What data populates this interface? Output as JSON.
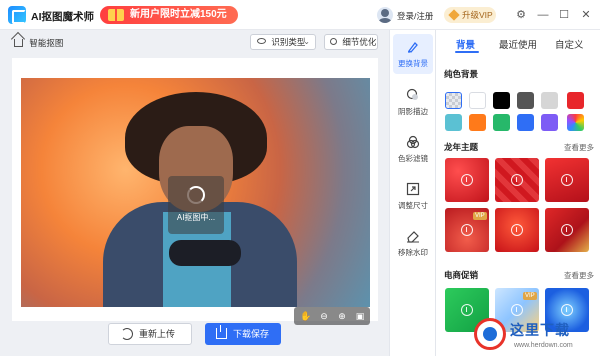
{
  "app": {
    "title": "AI抠图魔术师"
  },
  "promo": {
    "text": "新用户限时立减150元"
  },
  "account": {
    "login_label": "登录/注册",
    "vip_label": "升级VIP"
  },
  "window_controls": {
    "settings": "⚙",
    "minimize": "—",
    "maximize": "☐",
    "close": "✕"
  },
  "toolbar": {
    "smart_cutout_label": "智能抠图",
    "recognition_type_label": "识别类型",
    "detail_optimize_label": "细节优化"
  },
  "canvas": {
    "loading_text": "AI抠图中..."
  },
  "zoom_bar": {
    "icons": [
      "hand-icon",
      "zoom-out-icon",
      "zoom-in-icon",
      "fit-icon"
    ]
  },
  "actions": {
    "reupload_label": "重新上传",
    "download_label": "下载保存"
  },
  "tools": [
    {
      "label": "更换背景",
      "icon": "brush-icon",
      "active": true
    },
    {
      "label": "阴影描边",
      "icon": "shadow-icon",
      "active": false
    },
    {
      "label": "色彩滤镜",
      "icon": "filter-icon",
      "active": false
    },
    {
      "label": "调整尺寸",
      "icon": "resize-icon",
      "active": false
    },
    {
      "label": "移除水印",
      "icon": "eraser-icon",
      "active": false
    }
  ],
  "right_panel": {
    "tabs": [
      "背景",
      "最近使用",
      "自定义"
    ],
    "active_tab": "背景",
    "solid_section": {
      "title": "纯色背景",
      "colors": [
        "transparent",
        "#ffffff",
        "#000000",
        "#555555",
        "#d6d6d6",
        "#e8262b",
        "#5bc1d3",
        "#ff7a1a",
        "#27b86a",
        "#2f6ef5",
        "#7d5cf5",
        "rainbow"
      ]
    },
    "dragon_section": {
      "title": "龙年主题",
      "see_more": "查看更多",
      "vip_badge": "VIP"
    },
    "ecommerce_section": {
      "title": "电商促销",
      "see_more": "查看更多",
      "vip_badge": "VIP"
    }
  },
  "watermark": {
    "text": "这里下载",
    "url": "www.herdown.com"
  }
}
